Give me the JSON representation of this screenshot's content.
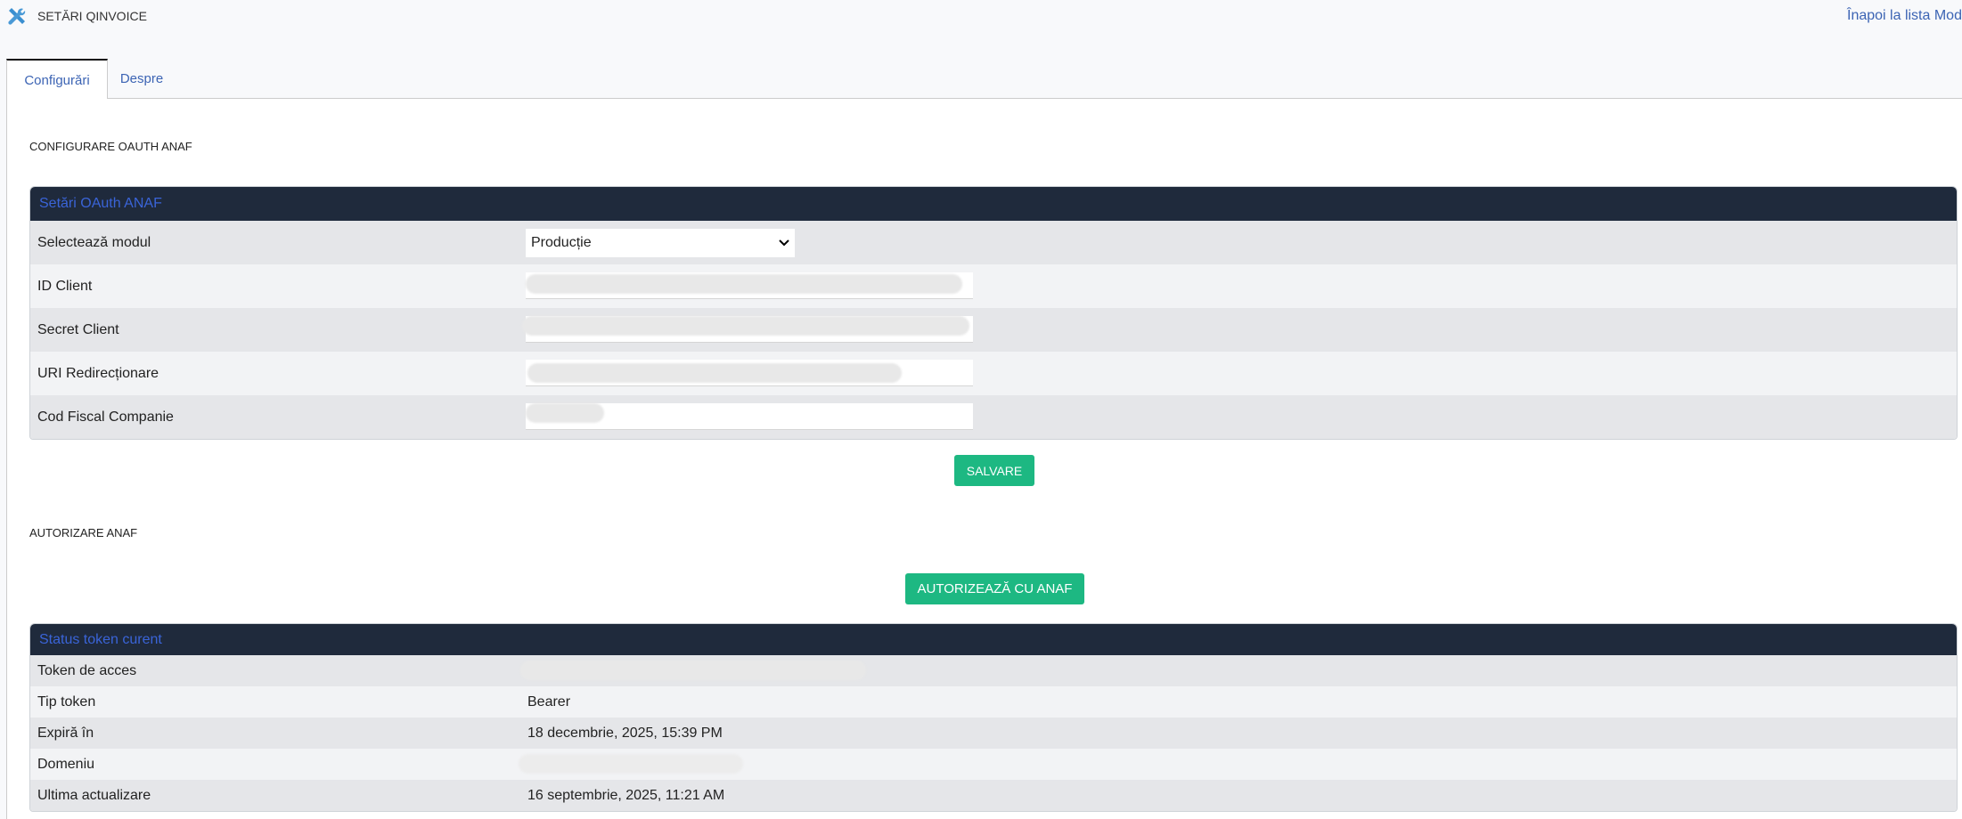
{
  "header": {
    "title": "SETĂRI QINVOICE",
    "back_link": "Înapoi la lista Mod"
  },
  "tabs": [
    {
      "label": "Configurări",
      "active": true
    },
    {
      "label": "Despre",
      "active": false
    }
  ],
  "oauth_section": {
    "title": "CONFIGURARE OAUTH ANAF",
    "panel_title": "Setări OAuth ANAF",
    "rows": [
      {
        "label": "Selectează modul",
        "value": "Producție"
      },
      {
        "label": "ID Client"
      },
      {
        "label": "Secret Client"
      },
      {
        "label": "URI Redirecționare"
      },
      {
        "label": "Cod Fiscal Companie"
      }
    ],
    "save_button": "SALVARE"
  },
  "auth_section": {
    "title": "AUTORIZARE ANAF",
    "authorize_button": "AUTORIZEAZĂ CU ANAF",
    "panel_title": "Status token curent",
    "rows": [
      {
        "label": "Token de acces"
      },
      {
        "label": "Tip token",
        "value": "Bearer"
      },
      {
        "label": "Expiră în",
        "value": "18 decembrie, 2025, 15:39 PM"
      },
      {
        "label": "Domeniu"
      },
      {
        "label": "Ultima actualizare",
        "value": "16 septembrie, 2025, 11:21 AM"
      }
    ]
  },
  "colors": {
    "accent": "#1db882",
    "panel_header": "#1f2a3c",
    "link": "#3c64b4"
  }
}
